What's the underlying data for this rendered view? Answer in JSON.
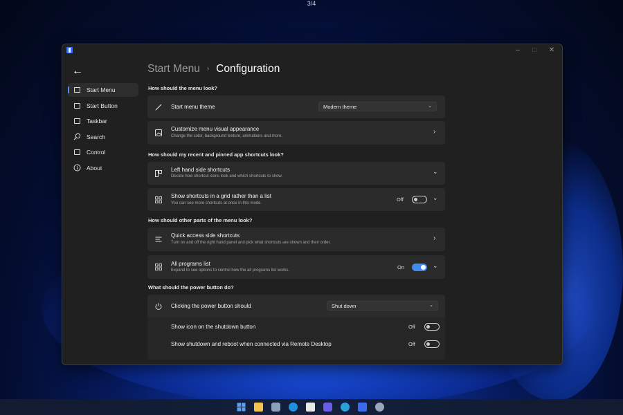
{
  "screen": {
    "counter": "3/4"
  },
  "window": {
    "breadcrumb": {
      "parent": "Start Menu",
      "separator": "›",
      "current": "Configuration"
    },
    "nav": {
      "items": [
        {
          "label": "Start Menu",
          "icon": "start-menu-icon",
          "selected": true
        },
        {
          "label": "Start Button",
          "icon": "start-button-icon"
        },
        {
          "label": "Taskbar",
          "icon": "taskbar-icon"
        },
        {
          "label": "Search",
          "icon": "search-icon"
        },
        {
          "label": "Control",
          "icon": "control-icon"
        },
        {
          "label": "About",
          "icon": "info-icon"
        }
      ]
    },
    "sections": [
      {
        "heading": "How should the menu look?"
      },
      {
        "heading": "How should my recent and pinned app shortcuts look?"
      },
      {
        "heading": "How should other parts of the menu look?"
      },
      {
        "heading": "What should the power button do?"
      }
    ],
    "settings": {
      "theme": {
        "title": "Start menu theme",
        "value": "Modern theme"
      },
      "appearance": {
        "title": "Customize menu visual appearance",
        "subtitle": "Change the color, background texture, animations and more."
      },
      "left_shortcuts": {
        "title": "Left hand side shortcuts",
        "subtitle": "Decide how shortcut icons look and which shortcuts to show."
      },
      "grid": {
        "title": "Show shortcuts in a grid rather than a list",
        "subtitle": "You can see more shortcuts at once in this mode.",
        "state": "Off"
      },
      "quick_access": {
        "title": "Quick access side shortcuts",
        "subtitle": "Turn on and off the right hand panel and pick what shortcuts are shown and their order."
      },
      "all_programs": {
        "title": "All programs list",
        "subtitle": "Expand to see options to control how the all programs list works.",
        "state": "On"
      },
      "power": {
        "title": "Clicking the power button should",
        "value": "Shut down"
      },
      "shutdown_icon": {
        "title": "Show icon on the shutdown button",
        "state": "Off"
      },
      "remote_desktop": {
        "title": "Show shutdown and reboot when connected via Remote Desktop",
        "state": "Off"
      }
    }
  },
  "colors": {
    "accent": "#3f8cf0",
    "window_bg": "#202020",
    "card_bg": "#2b2b2b"
  }
}
